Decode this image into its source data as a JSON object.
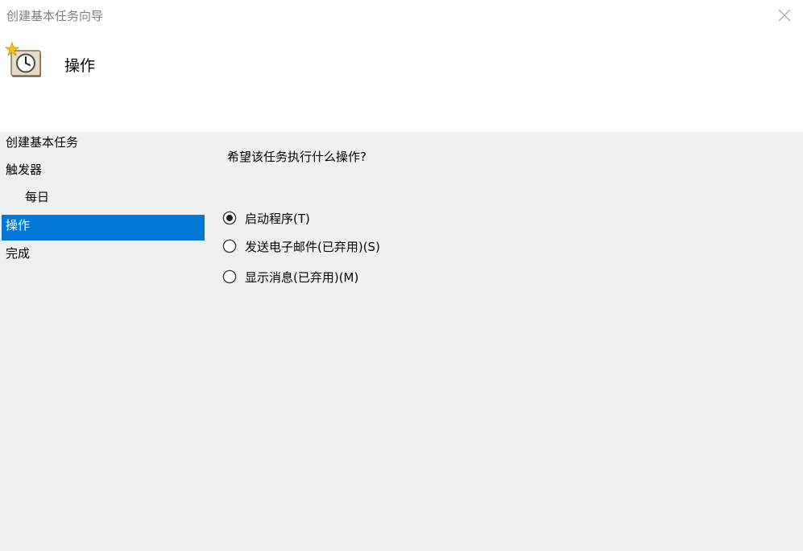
{
  "window": {
    "title": "创建基本任务向导"
  },
  "header": {
    "title": "操作"
  },
  "sidebar": {
    "items": [
      {
        "label": "创建基本任务"
      },
      {
        "label": "触发器"
      },
      {
        "label": "每日"
      },
      {
        "label": "操作"
      },
      {
        "label": "完成"
      }
    ],
    "selected": "操作"
  },
  "main": {
    "question": "希望该任务执行什么操作?",
    "options": [
      {
        "label": "启动程序(T)",
        "checked": true
      },
      {
        "label": "发送电子邮件(已弃用)(S)",
        "checked": false
      },
      {
        "label": "显示消息(已弃用)(M)",
        "checked": false
      }
    ]
  },
  "colors": {
    "selection": "#0078d7",
    "background": "#f0f0f0",
    "header_background": "#ffffff",
    "title_text": "#808080"
  },
  "icons": {
    "header": "scheduled-task-clock-icon",
    "close": "close-icon"
  }
}
